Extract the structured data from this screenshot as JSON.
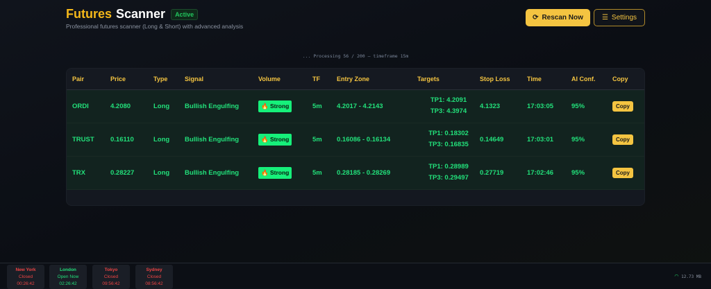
{
  "header": {
    "title_part1": "Futures",
    "title_part2": "Scanner",
    "status": "Active",
    "subtitle": "Professional futures scanner (Long & Short) with advanced analysis",
    "rescan_label": "Rescan Now",
    "settings_label": "Settings"
  },
  "progress": "... Processing 56 / 200 — timeframe 15m",
  "table": {
    "headers": [
      "Pair",
      "Price",
      "Type",
      "Signal",
      "Volume",
      "TF",
      "Entry Zone",
      "Targets",
      "Stop Loss",
      "Time",
      "AI Conf.",
      "Copy"
    ],
    "rows": [
      {
        "pair": "ORDI",
        "price": "4.2080",
        "type": "Long",
        "signal": "Bullish Engulfing",
        "volume": "Strong",
        "tf": "5m",
        "entry": "4.2017 - 4.2143",
        "tp1": "TP1: 4.2091",
        "tp3": "TP3: 4.3974",
        "stop": "4.1323",
        "time": "17:03:05",
        "conf": "95%",
        "copy": "Copy"
      },
      {
        "pair": "TRUST",
        "price": "0.16110",
        "type": "Long",
        "signal": "Bullish Engulfing",
        "volume": "Strong",
        "tf": "5m",
        "entry": "0.16086 - 0.16134",
        "tp1": "TP1: 0.18302",
        "tp3": "TP3: 0.16835",
        "stop": "0.14649",
        "time": "17:03:01",
        "conf": "95%",
        "copy": "Copy"
      },
      {
        "pair": "TRX",
        "price": "0.28227",
        "type": "Long",
        "signal": "Bullish Engulfing",
        "volume": "Strong",
        "tf": "5m",
        "entry": "0.28185 - 0.28269",
        "tp1": "TP1: 0.28989",
        "tp3": "TP3: 0.29497",
        "stop": "0.27719",
        "time": "17:02:46",
        "conf": "95%",
        "copy": "Copy"
      }
    ]
  },
  "sessions": [
    {
      "name": "New York",
      "status": "Closed",
      "time": "00:26:42",
      "color": "#ef4444"
    },
    {
      "name": "London",
      "status": "Open Now",
      "time": "02:26:42",
      "color": "#22e07a"
    },
    {
      "name": "Tokyo",
      "status": "Closed",
      "time": "09:56:42",
      "color": "#ef4444"
    },
    {
      "name": "Sydney",
      "status": "Closed",
      "time": "08:56:42",
      "color": "#ef4444"
    }
  ],
  "network": {
    "icon": "wifi-icon",
    "memory": "12.73 MB"
  }
}
